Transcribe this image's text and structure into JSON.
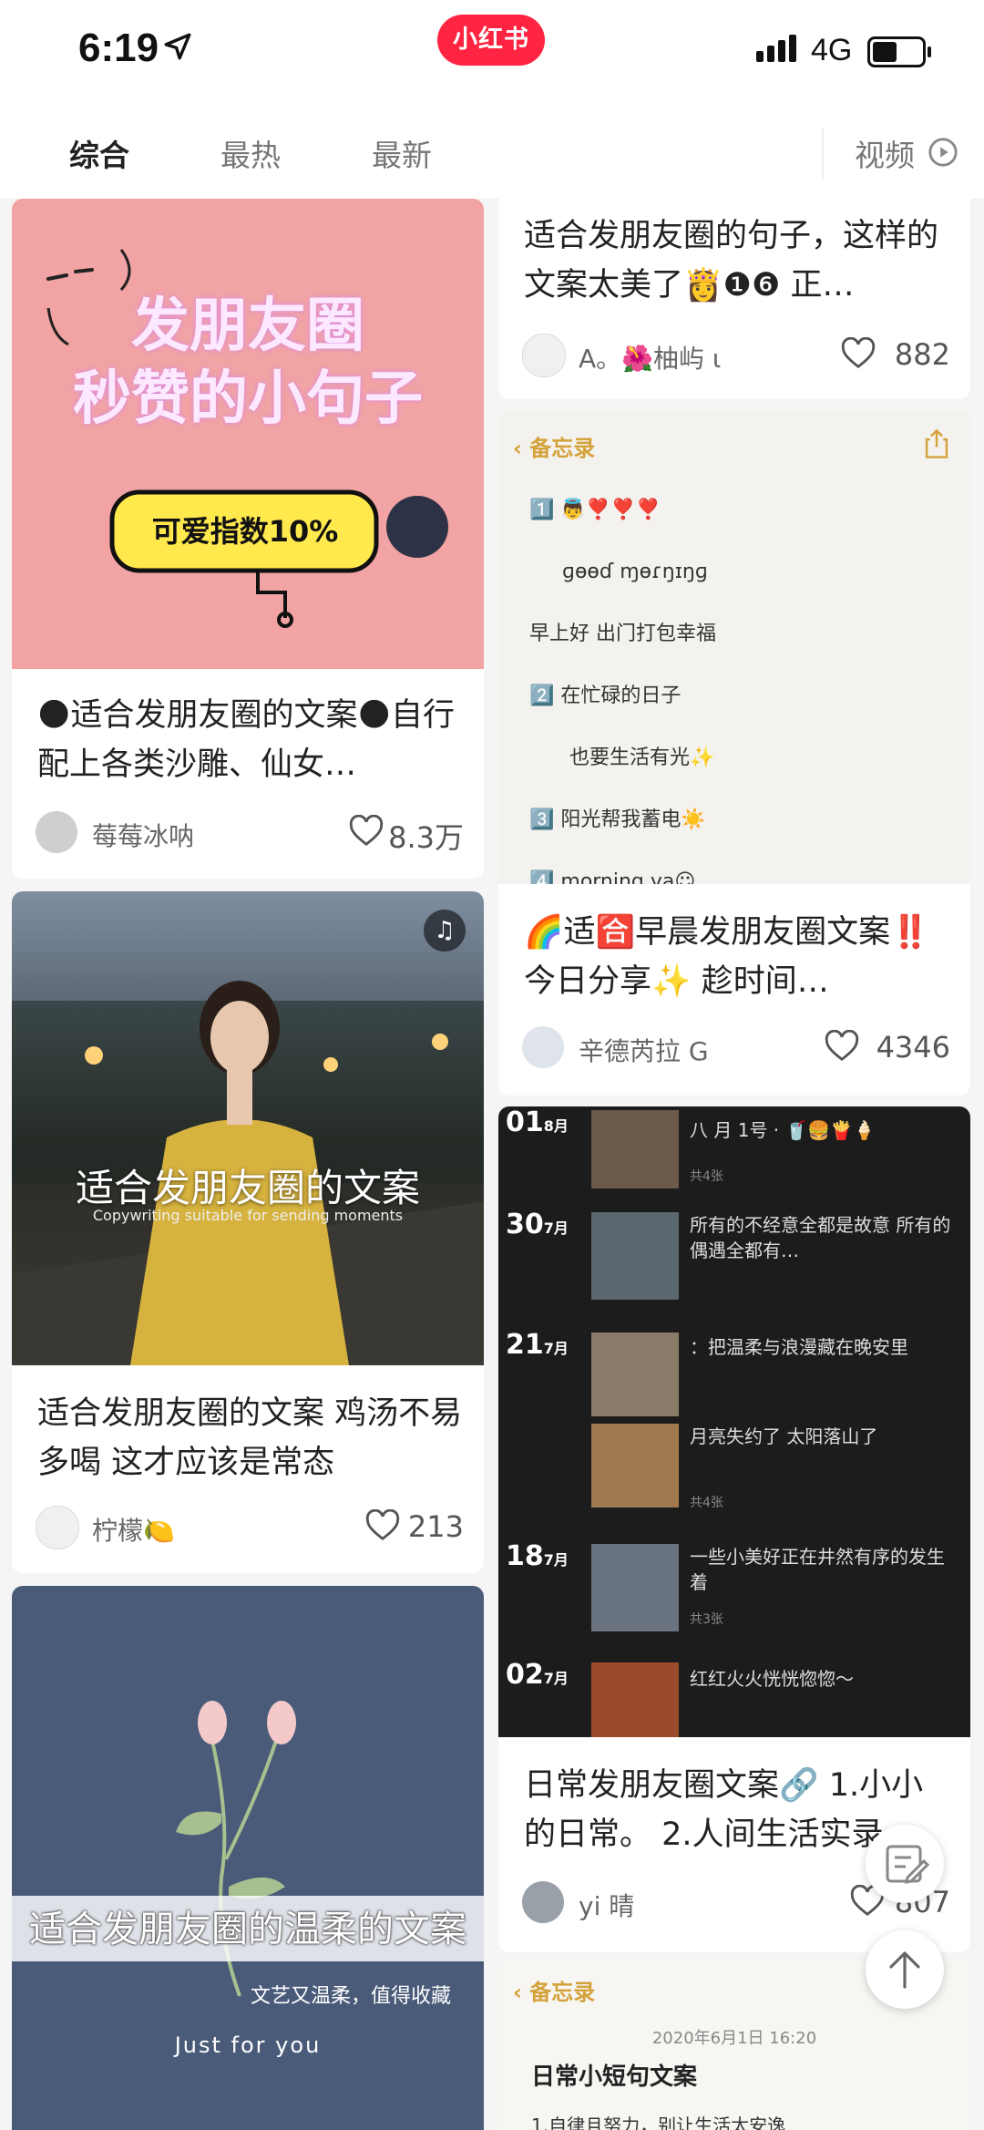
{
  "status": {
    "time": "6:19",
    "network": "4G",
    "app_badge": "小红书"
  },
  "tabs": {
    "items": [
      "综合",
      "最热",
      "最新"
    ],
    "active": "综合",
    "video": "视频"
  },
  "cards": [
    {
      "title": "🌑适合发朋友圈的文案🌑自行配上各类沙雕、仙女…",
      "author": "莓莓冰呐",
      "likes": "8.3万",
      "image": {
        "line1": "发朋友圈",
        "line2": "秒赞的小句子",
        "sticker": "可爱指数10%"
      }
    },
    {
      "title": "适合发朋友圈的句子，这样的文案太美了👸❶❻ 正…",
      "author": "A。🌺柚屿 ɩ",
      "likes": "882"
    },
    {
      "title": "🌈适🈴早晨发朋友圈文案‼️ 今日分享✨ 趁时间…",
      "author": "辛德芮拉 G",
      "likes": "4346",
      "image": {
        "back": "备忘录",
        "lines": [
          "1️⃣ 👼❣️❣️❣️",
          "ɡɵɵɗ ɱɵɾŋɪŋɡ",
          "早上好 出门打包幸福",
          "2️⃣ 在忙碌的日子",
          "也要生活有光✨",
          "3️⃣ 阳光帮我蓄电☀️",
          "4️⃣ morning ya☺"
        ]
      }
    },
    {
      "title": "适合发朋友圈的文案 鸡汤不易多喝 这才应该是常态",
      "author": "柠檬🍋",
      "likes": "213",
      "image": {
        "caption": "适合发朋友圈的文案",
        "sub": "Copywriting suitable for sending moments"
      }
    },
    {
      "title": "日常发朋友圈文案🔗 1.小小的日常。 2.人间生活实录…",
      "author": "yi 晴",
      "likes": "807",
      "image": {
        "entries": [
          {
            "day": "01",
            "month": "8月",
            "text": "八 月 1号 · 🥤🍔🍟🍦",
            "count": "共4张"
          },
          {
            "day": "30",
            "month": "7月",
            "text": "所有的不经意全都是故意 所有的偶遇全都有…",
            "count": ""
          },
          {
            "day": "21",
            "month": "7月",
            "text": "：把温柔与浪漫藏在晚安里",
            "count": ""
          },
          {
            "day": "",
            "month": "",
            "text": "月亮失约了 太阳落山了",
            "count": "共4张"
          },
          {
            "day": "18",
            "month": "7月",
            "text": "一些小美好正在井然有序的发生着",
            "count": "共3张"
          },
          {
            "day": "02",
            "month": "7月",
            "text": "红红火火恍恍惚惚～",
            "count": ""
          }
        ]
      }
    },
    {
      "title": "",
      "image": {
        "caption": "适合发朋友圈的温柔的文案",
        "sub": "文艺又温柔，值得收藏",
        "footer": "Just for you"
      }
    },
    {
      "title": "",
      "image": {
        "back": "备忘录",
        "date": "2020年6月1日 16:20",
        "heading": "日常小短句文案",
        "line": "1.自律且努力，别让生活太安逸"
      }
    }
  ],
  "colors": {
    "brand": "#ff2442",
    "memo_accent": "#d4a23a"
  }
}
